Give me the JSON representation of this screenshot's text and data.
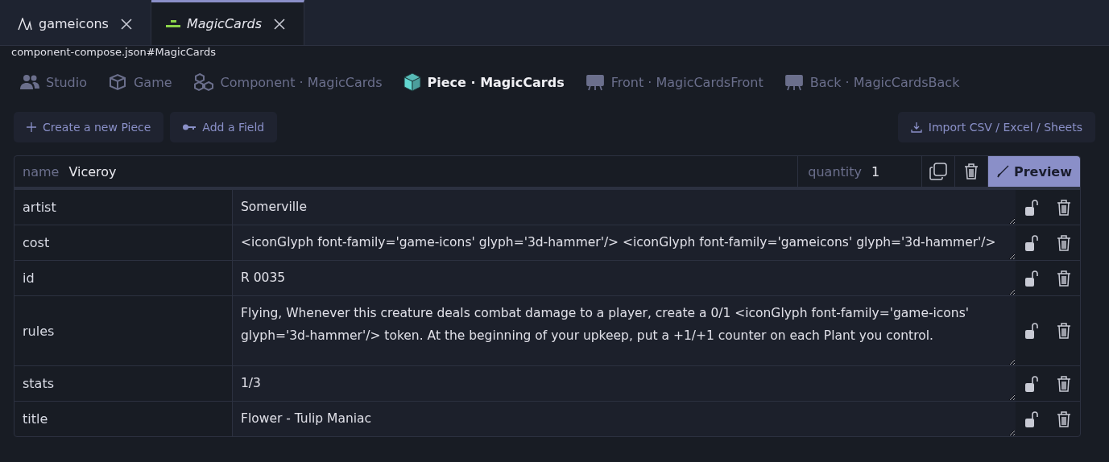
{
  "tabs": [
    {
      "label": "gameicons",
      "kind": "font",
      "selected": false
    },
    {
      "label": "MagicCards",
      "kind": "component",
      "selected": true
    }
  ],
  "path": "component-compose.json#MagicCards",
  "breadcrumb": [
    {
      "label": "Studio",
      "kind": "people",
      "selected": false
    },
    {
      "label": "Game",
      "kind": "box",
      "selected": false
    },
    {
      "label": "Component · MagicCards",
      "kind": "boxes",
      "selected": false
    },
    {
      "label": "Piece · MagicCards",
      "kind": "cube",
      "selected": true
    },
    {
      "label": "Front · MagicCardsFront",
      "kind": "easel",
      "selected": false
    },
    {
      "label": "Back · MagicCardsBack",
      "kind": "easel",
      "selected": false
    }
  ],
  "actions": [
    {
      "label": "Create a new Piece",
      "kind": "plus"
    },
    {
      "label": "Add a Field",
      "kind": "key"
    }
  ],
  "import_button": "Import CSV / Excel / Sheets",
  "piece": {
    "name_label": "name",
    "name": "Viceroy",
    "quantity_label": "quantity",
    "quantity": "1",
    "preview_button": "Preview"
  },
  "fields": [
    {
      "name": "artist",
      "value": "Somerville"
    },
    {
      "name": "cost",
      "value": "<iconGlyph font-family='game-icons' glyph='3d-hammer'/> <iconGlyph font-family='gameicons' glyph='3d-hammer'/>"
    },
    {
      "name": "id",
      "value": "R 0035"
    },
    {
      "name": "rules",
      "value": "Flying, Whenever this creature deals combat damage to a player, create a 0/1 <iconGlyph font-family='game-icons' glyph='3d-hammer'/> token. At the beginning of your upkeep, put a +1/+1 counter on each Plant you control.",
      "tall": true
    },
    {
      "name": "stats",
      "value": "1/3"
    },
    {
      "name": "title",
      "value": "Flower - Tulip Maniac"
    }
  ]
}
